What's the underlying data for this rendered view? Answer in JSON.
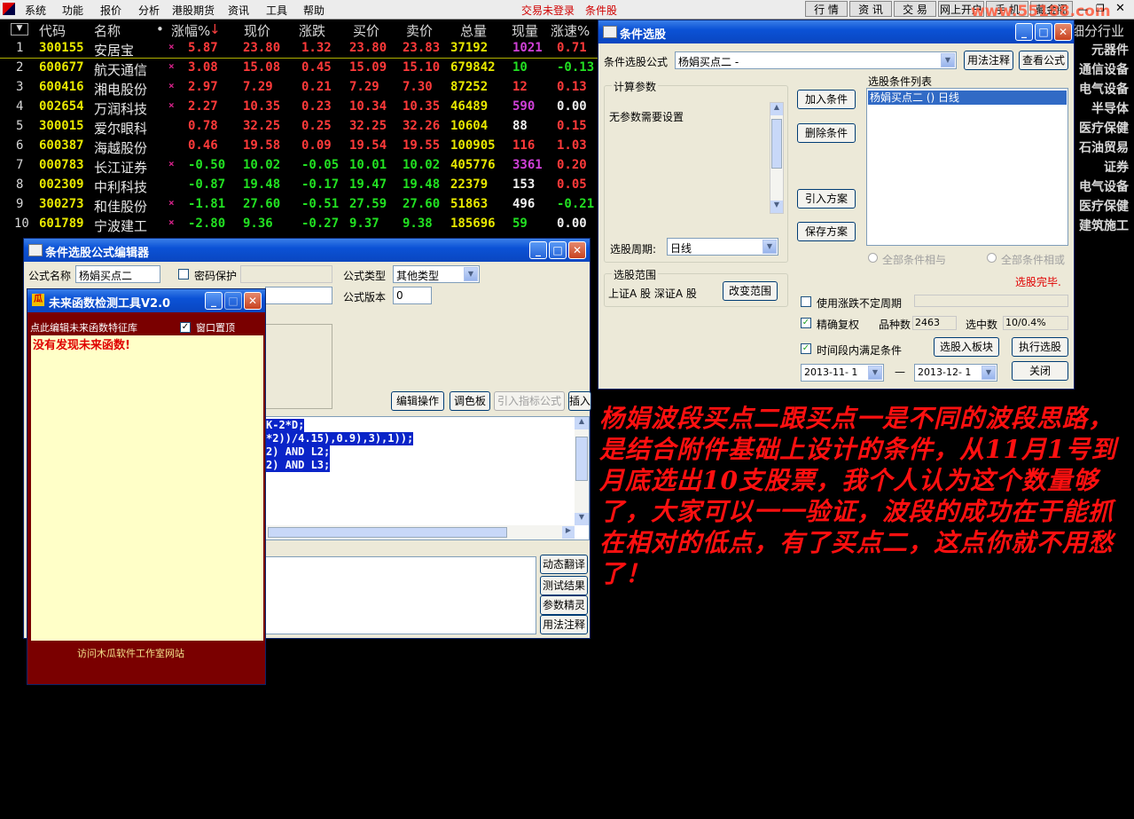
{
  "menubar": {
    "items": [
      "系统",
      "功能",
      "报价",
      "分析",
      "港股期货",
      "资讯",
      "工具",
      "帮助"
    ],
    "status1": "交易未登录",
    "status2": "条件股",
    "tabs": [
      "行 情",
      "资 讯",
      "交 易",
      "网上开户",
      "手 机",
      "藏金阁"
    ],
    "watermark": "www.55188.com"
  },
  "table": {
    "headers": [
      "代码",
      "名称",
      "涨幅%",
      "现价",
      "涨跌",
      "买价",
      "卖价",
      "总量",
      "现量",
      "涨速%"
    ],
    "rows": [
      {
        "idx": "1",
        "code": "300155",
        "name": "安居宝",
        "mk": "×",
        "pct": "5.87",
        "price": "23.80",
        "chg": "1.32",
        "bid": "23.80",
        "ask": "23.83",
        "vol": "37192",
        "cur": "1021",
        "speed": "0.71",
        "dir": "up",
        "curc": "mg",
        "spc": "up",
        "sector": "元器件"
      },
      {
        "idx": "2",
        "code": "600677",
        "name": "航天通信",
        "mk": "×",
        "pct": "3.08",
        "price": "15.08",
        "chg": "0.45",
        "bid": "15.09",
        "ask": "15.10",
        "vol": "679842",
        "cur": "10",
        "speed": "-0.13",
        "dir": "up",
        "curc": "dn",
        "spc": "dn",
        "sector": "通信设备"
      },
      {
        "idx": "3",
        "code": "600416",
        "name": "湘电股份",
        "mk": "×",
        "pct": "2.97",
        "price": "7.29",
        "chg": "0.21",
        "bid": "7.29",
        "ask": "7.30",
        "vol": "87252",
        "cur": "12",
        "speed": "0.13",
        "dir": "up",
        "curc": "up",
        "spc": "up",
        "sector": "电气设备"
      },
      {
        "idx": "4",
        "code": "002654",
        "name": "万润科技",
        "mk": "×",
        "pct": "2.27",
        "price": "10.35",
        "chg": "0.23",
        "bid": "10.34",
        "ask": "10.35",
        "vol": "46489",
        "cur": "590",
        "speed": "0.00",
        "dir": "up",
        "curc": "mg",
        "spc": "wh",
        "sector": "半导体"
      },
      {
        "idx": "5",
        "code": "300015",
        "name": "爱尔眼科",
        "mk": "",
        "pct": "0.78",
        "price": "32.25",
        "chg": "0.25",
        "bid": "32.25",
        "ask": "32.26",
        "vol": "10604",
        "cur": "88",
        "speed": "0.15",
        "dir": "up",
        "curc": "wh",
        "spc": "up",
        "sector": "医疗保健"
      },
      {
        "idx": "6",
        "code": "600387",
        "name": "海越股份",
        "mk": "",
        "pct": "0.46",
        "price": "19.58",
        "chg": "0.09",
        "bid": "19.54",
        "ask": "19.55",
        "vol": "100905",
        "cur": "116",
        "speed": "1.03",
        "dir": "up",
        "curc": "up",
        "spc": "up",
        "sector": "石油贸易"
      },
      {
        "idx": "7",
        "code": "000783",
        "name": "长江证券",
        "mk": "×",
        "pct": "-0.50",
        "price": "10.02",
        "chg": "-0.05",
        "bid": "10.01",
        "ask": "10.02",
        "vol": "405776",
        "cur": "3361",
        "speed": "0.20",
        "dir": "dn",
        "curc": "mg",
        "spc": "up",
        "sector": "证券"
      },
      {
        "idx": "8",
        "code": "002309",
        "name": "中利科技",
        "mk": "",
        "pct": "-0.87",
        "price": "19.48",
        "chg": "-0.17",
        "bid": "19.47",
        "ask": "19.48",
        "vol": "22379",
        "cur": "153",
        "speed": "0.05",
        "dir": "dn",
        "curc": "wh",
        "spc": "up",
        "sector": "电气设备"
      },
      {
        "idx": "9",
        "code": "300273",
        "name": "和佳股份",
        "mk": "×",
        "pct": "-1.81",
        "price": "27.60",
        "chg": "-0.51",
        "bid": "27.59",
        "ask": "27.60",
        "vol": "51863",
        "cur": "496",
        "speed": "-0.21",
        "dir": "dn",
        "curc": "wh",
        "spc": "dn",
        "sector": "医疗保健"
      },
      {
        "idx": "10",
        "code": "601789",
        "name": "宁波建工",
        "mk": "×",
        "pct": "-2.80",
        "price": "9.36",
        "chg": "-0.27",
        "bid": "9.37",
        "ask": "9.38",
        "vol": "185696",
        "cur": "59",
        "speed": "0.00",
        "dir": "dn",
        "curc": "dn",
        "spc": "wh",
        "sector": "建筑施工"
      }
    ],
    "top_sector": "细分行业"
  },
  "xgwin": {
    "title": "条件选股",
    "formula_label": "条件选股公式",
    "formula_value": "杨娟买点二 -",
    "usage_btn": "用法注释",
    "view_btn": "查看公式",
    "calc_group": "计算参数",
    "no_param": "无参数需要设置",
    "list_group": "选股条件列表",
    "list_item": "杨娟买点二  () 日线",
    "add_btn": "加入条件",
    "del_btn": "删除条件",
    "import_btn": "引入方案",
    "save_btn": "保存方案",
    "period_label": "选股周期:",
    "period_value": "日线",
    "all_and": "全部条件相与",
    "all_or": "全部条件相或",
    "done_text": "选股完毕.",
    "range_group": "选股范围",
    "range_value": "上证A 股  深证A 股",
    "change_range_btn": "改变范围",
    "use_uncertain": "使用涨跌不定周期",
    "precise": "精确复权",
    "count_label": "品种数",
    "count_value": "2463",
    "selected_label": "选中数",
    "selected_value": "10/0.4%",
    "time_cond": "时间段内满足条件",
    "to_board_btn": "选股入板块",
    "exec_btn": "执行选股",
    "date_from": "2013-11- 1",
    "date_sep": "—",
    "date_to": "2013-12- 1",
    "close_btn": "关闭"
  },
  "editor": {
    "title": "条件选股公式编辑器",
    "name_label": "公式名称",
    "name_value": "杨娟买点二",
    "pwd_label": "密码保护",
    "type_label": "公式类型",
    "type_value": "其他类型",
    "version_label": "公式版本",
    "version_value": "0",
    "edit_btn": "编辑操作",
    "palette_btn": "调色板",
    "import_idx_btn": "引入指标公式",
    "insert_btn": "插入",
    "code": [
      "K-2*D;",
      "*2))/4.15),0.9),3),1));",
      "2) AND L2;",
      "2) AND L3;"
    ],
    "dyn_btn": "动态翻译",
    "test_btn": "测试结果",
    "param_btn": "参数精灵",
    "usage_btn": "用法注释"
  },
  "future": {
    "title": "未来函数检测工具V2.0",
    "edit_lib": "点此编辑未来函数特征库",
    "topmost": "窗口置顶",
    "result": "没有发现未来函数!",
    "visit": "访问木瓜软件工作室网站"
  },
  "overlay": {
    "text": "杨娟波段买点二跟买点一是不同的波段思路，是结合附件基础上设计的条件，从11月1号到月底选出10支股票，我个人认为这个数量够了，大家可以一一验证，波段的成功在于能抓在相对的低点，有了买点二，这点你就不用愁了！"
  }
}
